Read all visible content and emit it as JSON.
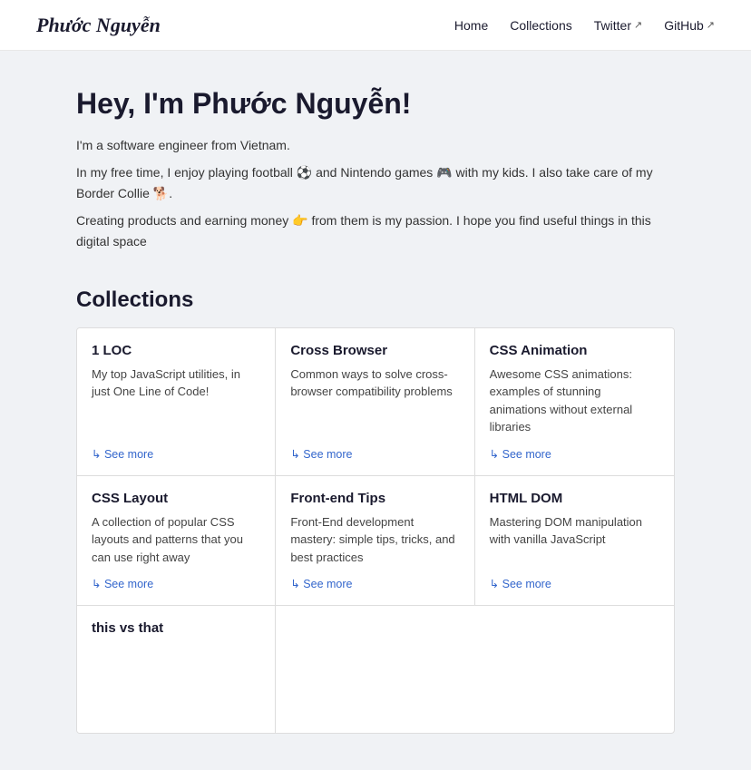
{
  "nav": {
    "logo": "Phước Nguyễn",
    "links": [
      {
        "label": "Home",
        "href": "#",
        "external": false
      },
      {
        "label": "Collections",
        "href": "#",
        "external": false
      },
      {
        "label": "Twitter",
        "href": "#",
        "external": true
      },
      {
        "label": "GitHub",
        "href": "#",
        "external": true
      }
    ]
  },
  "hero": {
    "heading": "Hey, I'm Phước Nguyễn!",
    "paragraphs": [
      "I'm a software engineer from Vietnam.",
      "In my free time, I enjoy playing football ⚽ and Nintendo games 🎮 with my kids. I also take care of my Border Collie 🐕.",
      "Creating products and earning money 👉 from them is my passion. I hope you find useful things in this digital space"
    ]
  },
  "collections": {
    "section_title": "Collections",
    "items": [
      {
        "title": "1 LOC",
        "description": "My top JavaScript utilities, in just One Line of Code!",
        "see_more": "↳ See more"
      },
      {
        "title": "Cross Browser",
        "description": "Common ways to solve cross-browser compatibility problems",
        "see_more": "↳ See more"
      },
      {
        "title": "CSS Animation",
        "description": "Awesome CSS animations: examples of stunning animations without external libraries",
        "see_more": "↳ See more"
      },
      {
        "title": "CSS Layout",
        "description": "A collection of popular CSS layouts and patterns that you can use right away",
        "see_more": "↳ See more"
      },
      {
        "title": "Front-end Tips",
        "description": "Front-End development mastery: simple tips, tricks, and best practices",
        "see_more": "↳ See more"
      },
      {
        "title": "HTML DOM",
        "description": "Mastering DOM manipulation with vanilla JavaScript",
        "see_more": "↳ See more"
      },
      {
        "title": "this vs that",
        "description": "",
        "see_more": ""
      }
    ]
  }
}
